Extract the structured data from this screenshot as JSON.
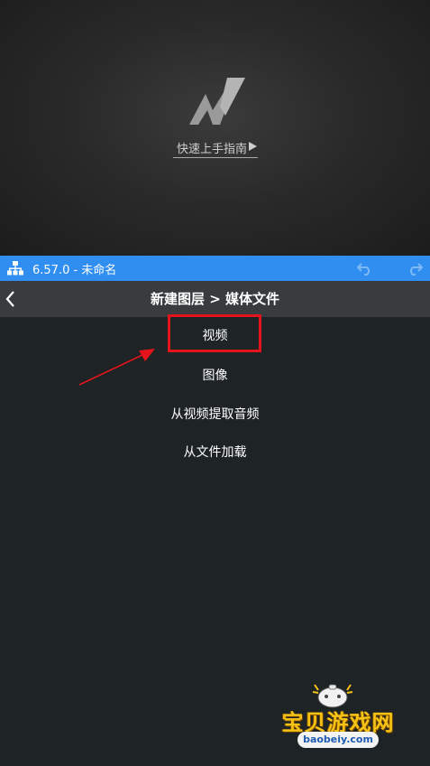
{
  "preview": {
    "guide_label": "快速上手指南"
  },
  "project_bar": {
    "title": "6.57.0 - 未命名"
  },
  "header": {
    "title": "新建图层 > 媒体文件"
  },
  "menu": {
    "items": [
      {
        "label": "视频"
      },
      {
        "label": "图像"
      },
      {
        "label": "从视频提取音频"
      },
      {
        "label": "从文件加载"
      }
    ]
  },
  "annotation": {
    "highlight_color": "#e4141c"
  },
  "watermark": {
    "text": "宝贝游戏网",
    "subtext": "baobeiy.com"
  },
  "colors": {
    "accent": "#2f8ef0",
    "header_bg": "#383c3f",
    "panel_bg": "#1e2325"
  }
}
